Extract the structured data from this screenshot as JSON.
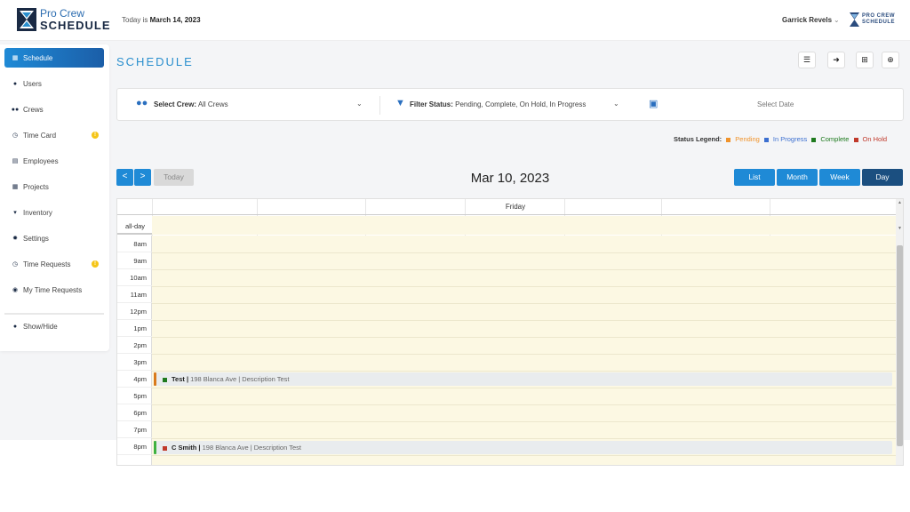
{
  "header": {
    "logo_top": "Pro Crew",
    "logo_bottom": "SCHEDULE",
    "today_prefix": "Today is",
    "today_date": "March 14, 2023",
    "user_name": "Garrick Revels",
    "small_logo_top": "PRO CREW",
    "small_logo_bottom": "SCHEDULE"
  },
  "sidebar": {
    "items": [
      {
        "label": "Schedule",
        "icon": "calendar-icon",
        "active": true
      },
      {
        "label": "Users",
        "icon": "user-icon"
      },
      {
        "label": "Crews",
        "icon": "users-icon"
      },
      {
        "label": "Time Card",
        "icon": "clock-icon",
        "badge": "!"
      },
      {
        "label": "Employees",
        "icon": "id-card-icon"
      },
      {
        "label": "Projects",
        "icon": "grid-icon"
      },
      {
        "label": "Inventory",
        "icon": "basket-icon"
      },
      {
        "label": "Settings",
        "icon": "gear-icon"
      },
      {
        "label": "Time Requests",
        "icon": "clock-icon",
        "badge": "!"
      },
      {
        "label": "My Time Requests",
        "icon": "user-circle-icon"
      }
    ],
    "show_hide": "Show/Hide"
  },
  "page": {
    "title": "SCHEDULE"
  },
  "filters": {
    "crew_label": "Select Crew:",
    "crew_value": "All Crews",
    "status_label": "Filter Status:",
    "status_value": "Pending, Complete, On Hold, In Progress",
    "date_placeholder": "Select Date"
  },
  "legend": {
    "label": "Status Legend:",
    "items": [
      {
        "label": "Pending",
        "color": "#f0932b"
      },
      {
        "label": "In Progress",
        "color": "#3b6fd0"
      },
      {
        "label": "Complete",
        "color": "#1e7a1e"
      },
      {
        "label": "On Hold",
        "color": "#c0392b"
      }
    ]
  },
  "calendar": {
    "title": "Mar 10, 2023",
    "today_label": "Today",
    "prev_icon": "<",
    "next_icon": ">",
    "views": [
      "List",
      "Month",
      "Week",
      "Day"
    ],
    "active_view": "Day",
    "day_header": "Friday",
    "allday_label": "all-day",
    "hours": [
      "8am",
      "9am",
      "10am",
      "11am",
      "12pm",
      "1pm",
      "2pm",
      "3pm",
      "4pm",
      "5pm",
      "6pm",
      "7pm",
      "8pm"
    ],
    "events": [
      {
        "title": "Test",
        "address": "198 Blanca Ave",
        "description": "Description Test",
        "bar_color": "#d97a1c",
        "status_color": "#1e7a1e"
      },
      {
        "title": "C Smith",
        "address": "198 Blanca Ave",
        "description": "Description Test",
        "bar_color": "#3fb13f",
        "status_color": "#c0392b"
      }
    ]
  }
}
